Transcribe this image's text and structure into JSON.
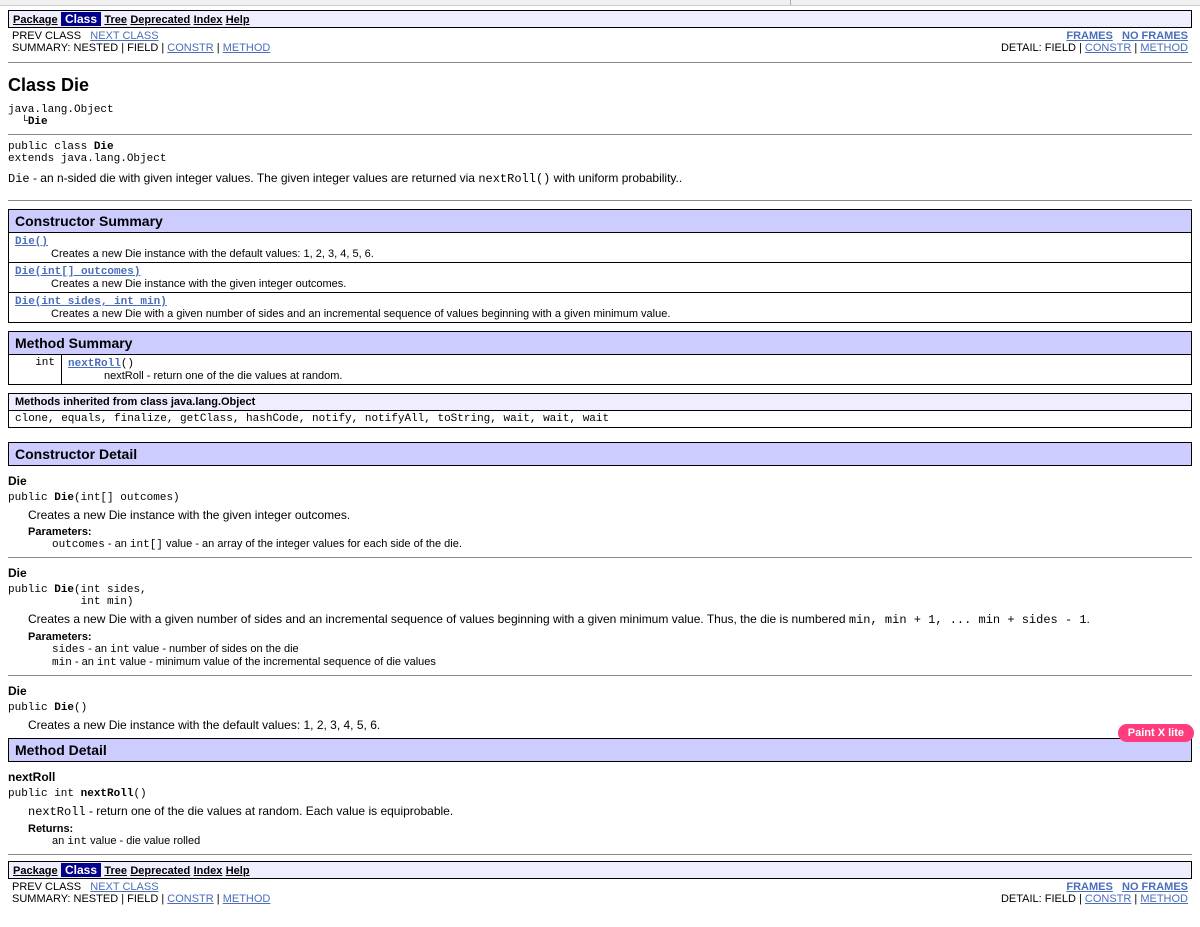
{
  "nav": {
    "items": [
      "Package",
      "Class",
      "Tree",
      "Deprecated",
      "Index",
      "Help"
    ],
    "selected_index": 1,
    "prev_class": "PREV CLASS",
    "next_class": "NEXT CLASS",
    "summary_prefix": "SUMMARY: NESTED | FIELD | ",
    "constr": "CONSTR",
    "method": "METHOD",
    "detail_prefix": "DETAIL: FIELD | ",
    "frames": "FRAMES",
    "noframes": "NO FRAMES",
    "pipe": " | "
  },
  "class": {
    "title": "Class Die",
    "hierarchy_root": "java.lang.Object",
    "hierarchy_leaf": "Die",
    "decl_line1": "public class ",
    "decl_name": "Die",
    "decl_line2": "extends java.lang.Object",
    "desc_pre": "Die",
    "desc_text": " - an n-sided die with given integer values. The given integer values are returned via ",
    "desc_code": "nextRoll()",
    "desc_tail": " with uniform probability.."
  },
  "constructor_summary": {
    "head": "Constructor Summary",
    "rows": [
      {
        "sig": "Die()",
        "desc": "Creates a new Die instance with the default values: 1, 2, 3, 4, 5, 6."
      },
      {
        "sig": "Die(int[] outcomes)",
        "desc": "Creates a new Die instance with the given integer outcomes."
      },
      {
        "sig": "Die(int sides, int min)",
        "desc": "Creates a new Die with a given number of sides and an incremental sequence of values beginning with a given minimum value."
      }
    ]
  },
  "method_summary": {
    "head": "Method Summary",
    "rows": [
      {
        "ret": " int",
        "name": "nextRoll",
        "sig_tail": "()",
        "desc": "nextRoll - return one of the die values at random."
      }
    ]
  },
  "inherited": {
    "head": "Methods inherited from class java.lang.Object",
    "list": "clone, equals, finalize, getClass, hashCode, notify, notifyAll, toString, wait, wait, wait"
  },
  "constructor_detail": {
    "head": "Constructor Detail",
    "c1": {
      "name": "Die",
      "decl": "public Die(int[] outcomes)",
      "desc": "Creates a new Die instance with the given integer outcomes.",
      "params_label": "Parameters:",
      "p1": "outcomes - an int[] value - an array of the integer values for each side of the die."
    },
    "c2": {
      "name": "Die",
      "decl": "public Die(int sides,\n           int min)",
      "desc_pre": "Creates a new Die with a given number of sides and an incremental sequence of values beginning with a given minimum value. Thus, the die is numbered ",
      "desc_code": "min, min + 1, ... min + sides - 1",
      "desc_tail": ".",
      "params_label": "Parameters:",
      "p1": "sides - an int value - number of sides on the die",
      "p2": "min - an int value - minimum value of the incremental sequence of die values"
    },
    "c3": {
      "name": "Die",
      "decl": "public Die()",
      "desc": "Creates a new Die instance with the default values: 1, 2, 3, 4, 5, 6."
    }
  },
  "method_detail": {
    "head": "Method Detail",
    "m1": {
      "name": "nextRoll",
      "decl": "public int nextRoll()",
      "desc": "nextRoll - return one of the die values at random. Each value is equiprobable.",
      "returns_label": "Returns:",
      "returns": "an int value - die value rolled"
    }
  },
  "watermark": "Paint X lite"
}
